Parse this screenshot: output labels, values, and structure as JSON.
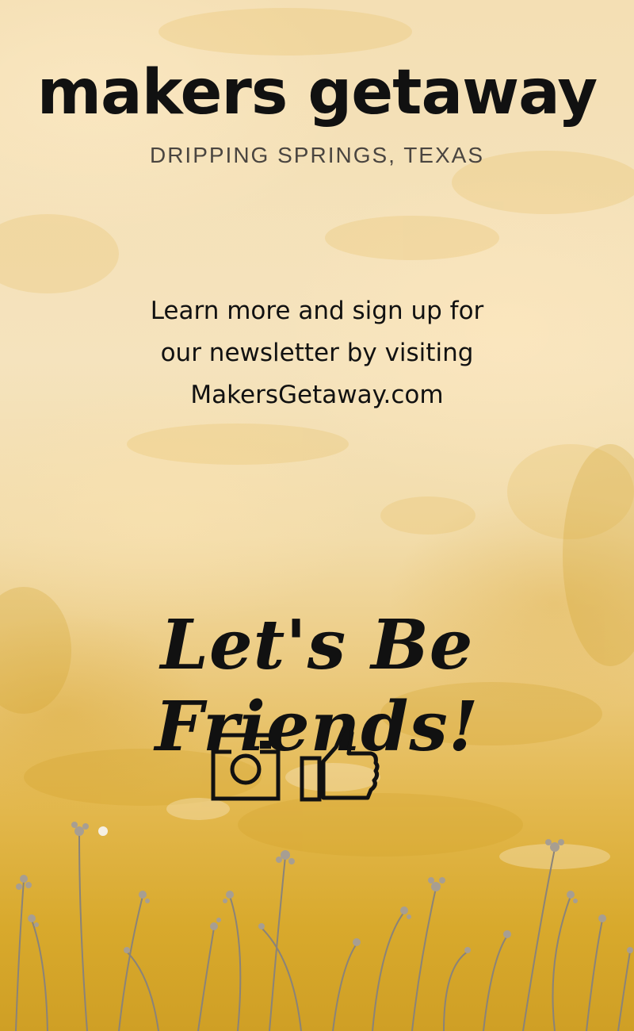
{
  "header": {
    "brand": "makers getaway",
    "location": "DRIPPING SPRINGS, TEXAS"
  },
  "info": {
    "line1": "Learn more and sign up for",
    "line2": "our newsletter by visiting",
    "line3": "MakersGetaway.com"
  },
  "social": {
    "heading": "Let's Be Friends!",
    "icons": [
      "instagram-icon",
      "thumbs-up-icon"
    ]
  },
  "colors": {
    "text": "#111111",
    "subtitle": "#4a4540",
    "wall_light": "#f5e3bd",
    "wall_yellow": "#d8a92c"
  }
}
